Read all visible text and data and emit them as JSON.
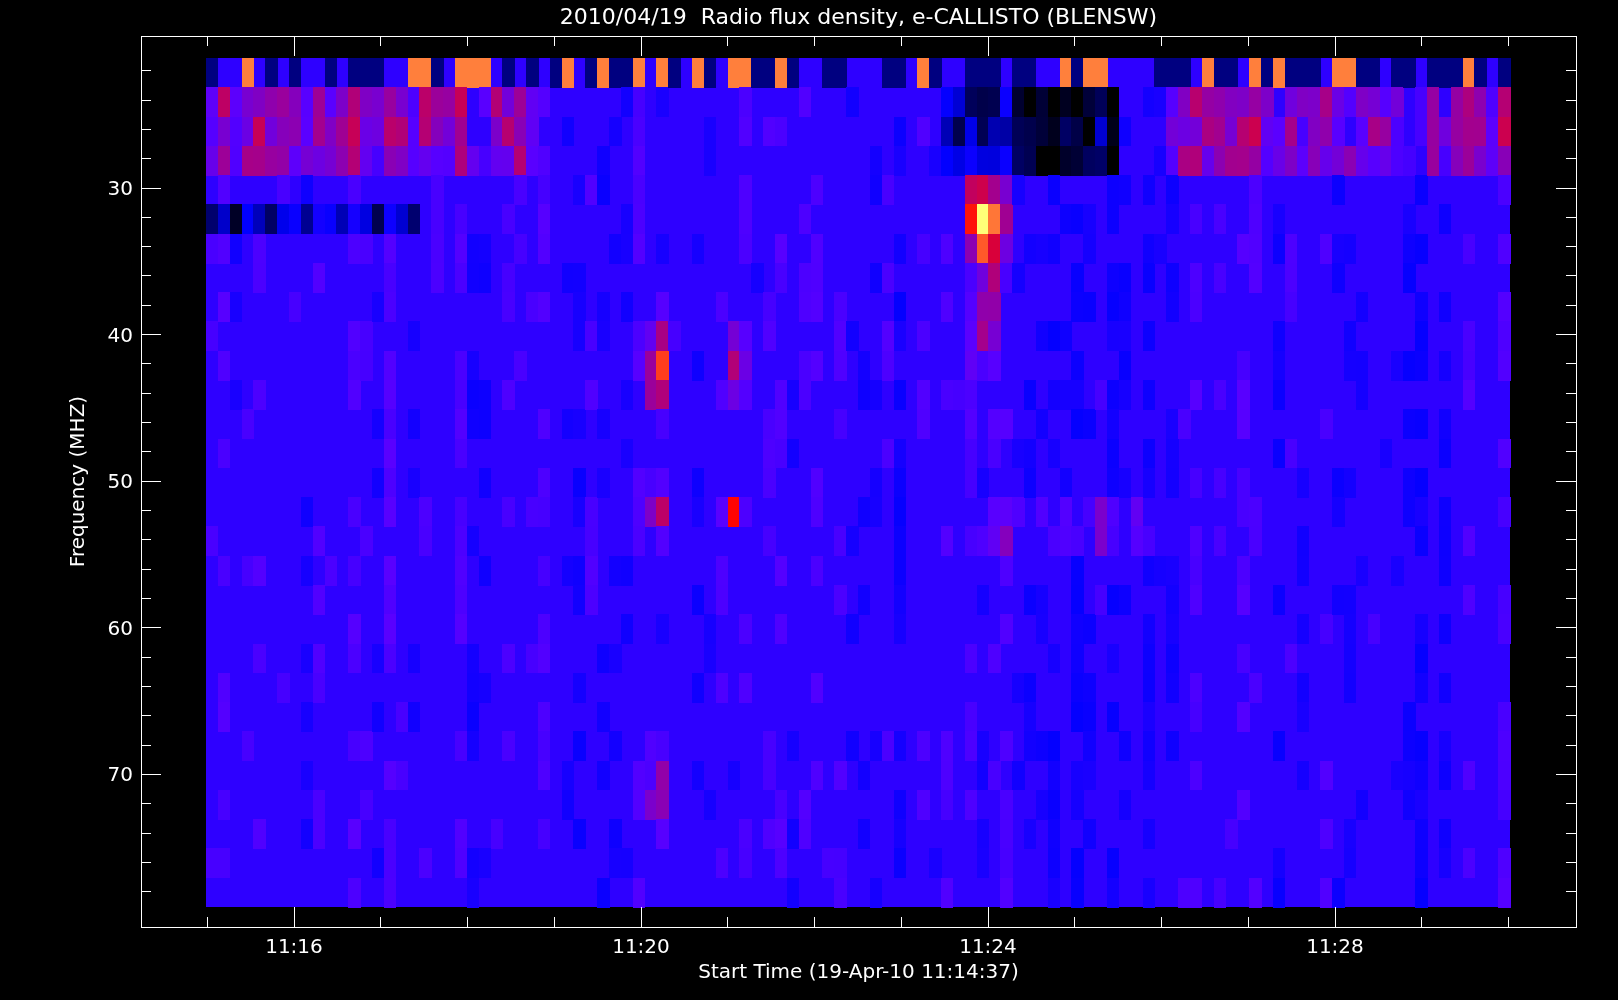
{
  "plot": {
    "title": "2010/04/19  Radio flux density, e-CALLISTO (BLENSW)",
    "ylabel": "Frequency (MHZ)",
    "xlabel": "Start Time (19-Apr-10 11:14:37)",
    "yticks": [
      "30",
      "40",
      "50",
      "60",
      "70"
    ],
    "xticks": [
      "11:16",
      "11:20",
      "11:24",
      "11:28"
    ]
  }
}
